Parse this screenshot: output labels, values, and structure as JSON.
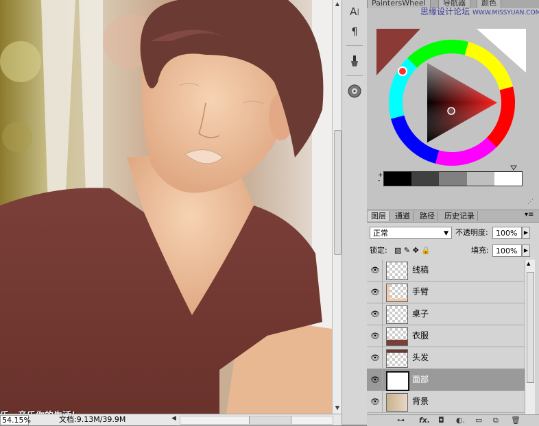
{
  "canvas": {
    "caption": "乐，音乐你的生活！"
  },
  "status": {
    "zoom": "54.15%",
    "doc_info": "文档:9.13M/39.9M"
  },
  "dock": {
    "tools": [
      "character-icon",
      "paragraph-icon",
      "brush-tool-icon",
      "disc-icon"
    ]
  },
  "wheel_panel": {
    "tabs": [
      "PaintersWheel",
      "导航器",
      "颜色"
    ],
    "watermark": "思缘设计论坛",
    "watermark_url": "WWW.MISSYUAN.COM",
    "foreground_color": "#8b3a36",
    "background_color": "#ffffff",
    "swatches": [
      "#000000",
      "#404040",
      "#808080",
      "#bfbfbf",
      "#ffffff"
    ]
  },
  "layers_panel": {
    "tabs": [
      "图层",
      "通道",
      "路径",
      "历史记录"
    ],
    "blend_mode": "正常",
    "opacity_label": "不透明度:",
    "opacity_value": "100%",
    "lock_label": "锁定:",
    "fill_label": "填充:",
    "fill_value": "100%",
    "layers": [
      {
        "name": "线稿",
        "selected": false
      },
      {
        "name": "手臂",
        "selected": false
      },
      {
        "name": "桌子",
        "selected": false
      },
      {
        "name": "衣服",
        "selected": false
      },
      {
        "name": "头发",
        "selected": false
      },
      {
        "name": "面部",
        "selected": true
      },
      {
        "name": "背景",
        "selected": false
      }
    ],
    "bottom_icons": [
      "link-icon",
      "fx-icon",
      "mask-icon",
      "adjustment-icon",
      "group-folder-icon",
      "new-layer-icon",
      "trash-icon"
    ]
  }
}
